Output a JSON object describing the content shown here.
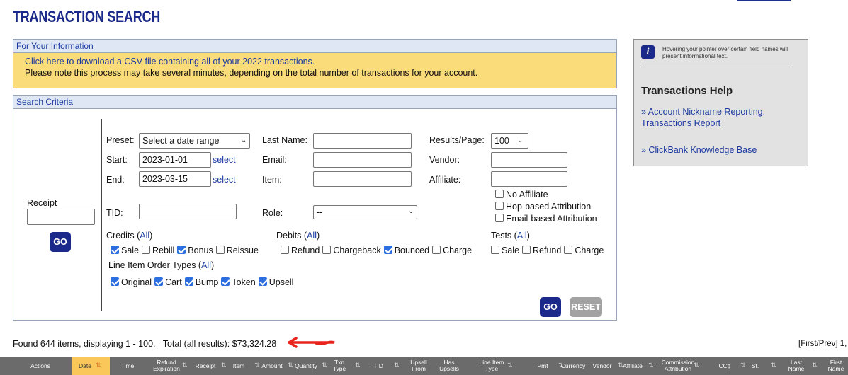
{
  "page_title": "TRANSACTION SEARCH",
  "info": {
    "header": "For Your Information",
    "csv_link": "Click here to download a CSV file containing all of your 2022 transactions.",
    "note": "Please note this process may take several minutes, depending on the total number of transactions for your account."
  },
  "search": {
    "header": "Search Criteria",
    "receipt_label": "Receipt",
    "receipt_value": "",
    "go_label": "GO",
    "preset_label": "Preset:",
    "preset_value": "Select a date range",
    "start_label": "Start:",
    "start_value": "2023-01-01",
    "end_label": "End:",
    "end_value": "2023-03-15",
    "select_link": "select",
    "tid_label": "TID:",
    "tid_value": "",
    "last_name_label": "Last Name:",
    "email_label": "Email:",
    "item_label": "Item:",
    "role_label": "Role:",
    "role_value": "--",
    "results_label": "Results/Page:",
    "results_value": "100",
    "vendor_label": "Vendor:",
    "affiliate_label": "Affiliate:",
    "no_affiliate": "No Affiliate",
    "hop_attr": "Hop-based Attribution",
    "email_attr": "Email-based Attribution",
    "credits_label": "Credits (",
    "debits_label": "Debits (",
    "tests_label": "Tests (",
    "all_link": "All",
    "close_paren": ")",
    "credits": [
      {
        "label": "Sale",
        "checked": true
      },
      {
        "label": "Rebill",
        "checked": false
      },
      {
        "label": "Bonus",
        "checked": true
      },
      {
        "label": "Reissue",
        "checked": false
      }
    ],
    "debits": [
      {
        "label": "Refund",
        "checked": false
      },
      {
        "label": "Chargeback",
        "checked": false
      },
      {
        "label": "Bounced",
        "checked": true
      },
      {
        "label": "Charge",
        "checked": false
      }
    ],
    "tests": [
      {
        "label": "Sale",
        "checked": false
      },
      {
        "label": "Refund",
        "checked": false
      },
      {
        "label": "Charge",
        "checked": false
      }
    ],
    "line_item_label": "Line Item Order Types (",
    "line_items": [
      {
        "label": "Original",
        "checked": true
      },
      {
        "label": "Cart",
        "checked": true
      },
      {
        "label": "Bump",
        "checked": true
      },
      {
        "label": "Token",
        "checked": true
      },
      {
        "label": "Upsell",
        "checked": true
      }
    ],
    "reset_label": "RESET"
  },
  "help": {
    "icon": "info-icon",
    "note": "Hovering your pointer over certain field names will present informational text.",
    "title": "Transactions Help",
    "link1": "» Account Nickname Reporting: Transactions Report",
    "link2": "» ClickBank Knowledge Base"
  },
  "results": {
    "summary": "Found 644 items, displaying 1 - 100.   Total (all results): $73,324.28",
    "paging": "[First/Prev] 1,"
  },
  "table_headers": [
    "Actions",
    "Date",
    "Time",
    "Refund Expiration",
    "Receipt",
    "Item",
    "Amount",
    "Quantity",
    "Txn Type",
    "TID",
    "Upsell From",
    "Has Upsells",
    "Line Item Type",
    "Pmt",
    "Currency",
    "Vendor",
    "Affiliate",
    "Commission Attribution",
    "CC‡",
    "St.",
    "Last Name",
    "First Name"
  ],
  "colors": {
    "accent": "#1b2a8a",
    "info_bg": "#fadc7b",
    "sorted_col": "#f9c75a",
    "arrow": "#e8241c"
  }
}
